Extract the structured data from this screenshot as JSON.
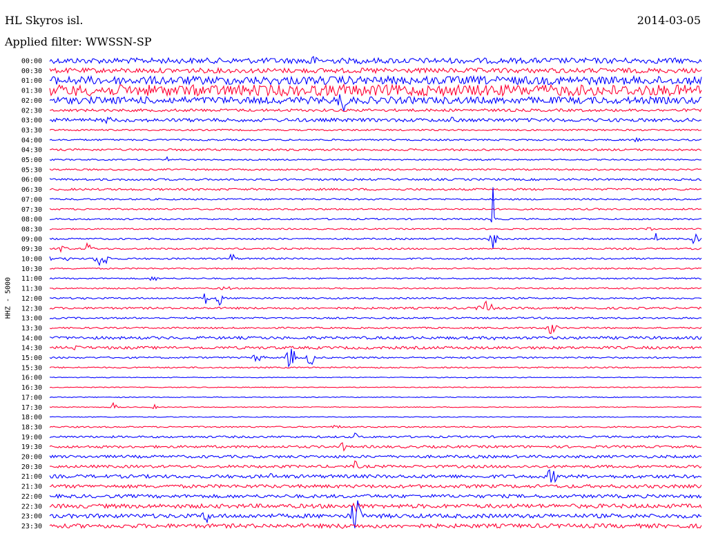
{
  "header": {
    "station": "HL Skyros isl.",
    "date": "2014-03-05",
    "filter": "Applied filter: WWSSN-SP",
    "channel": "HHZ - 5000"
  },
  "chart_data": {
    "type": "line",
    "title": "HL Skyros isl.",
    "subtitle": "Applied filter: WWSSN-SP",
    "ylabel": "HHZ - 5000",
    "colors": [
      "#0000ff",
      "#ff0033"
    ],
    "rows": [
      {
        "label": "00:00",
        "noise": 4,
        "events": [
          [
            0.4,
            5,
            10
          ],
          [
            0.48,
            3,
            6
          ]
        ]
      },
      {
        "label": "00:30",
        "noise": 3.5,
        "events": [
          [
            0.5,
            2,
            5
          ],
          [
            0.78,
            3,
            4
          ]
        ]
      },
      {
        "label": "01:00",
        "noise": 6,
        "events": [
          [
            0.5,
            5,
            6
          ]
        ]
      },
      {
        "label": "01:30",
        "noise": 8,
        "events": [
          [
            0.45,
            6,
            10
          ]
        ]
      },
      {
        "label": "02:00",
        "noise": 5,
        "events": [
          [
            0.45,
            5,
            16
          ],
          [
            0.14,
            3,
            6
          ]
        ]
      },
      {
        "label": "02:30",
        "noise": 2,
        "events": []
      },
      {
        "label": "03:00",
        "noise": 2.5,
        "events": [
          [
            0.09,
            3,
            6
          ],
          [
            0.62,
            3,
            6
          ]
        ]
      },
      {
        "label": "03:30",
        "noise": 1.2,
        "events": []
      },
      {
        "label": "04:00",
        "noise": 1.2,
        "events": [
          [
            0.9,
            4,
            3
          ]
        ]
      },
      {
        "label": "04:30",
        "noise": 1.5,
        "events": [
          [
            0.05,
            5,
            3
          ]
        ]
      },
      {
        "label": "05:00",
        "noise": 1,
        "events": [
          [
            0.18,
            1,
            5
          ]
        ]
      },
      {
        "label": "05:30",
        "noise": 1.2,
        "events": []
      },
      {
        "label": "06:00",
        "noise": 1.5,
        "events": []
      },
      {
        "label": "06:30",
        "noise": 1.5,
        "events": []
      },
      {
        "label": "07:00",
        "noise": 1.2,
        "events": []
      },
      {
        "label": "07:30",
        "noise": 1.2,
        "events": []
      },
      {
        "label": "08:00",
        "noise": 1.2,
        "events": [
          [
            0.68,
            1,
            90
          ]
        ]
      },
      {
        "label": "08:30",
        "noise": 1,
        "events": [
          [
            0.92,
            3,
            4
          ]
        ]
      },
      {
        "label": "09:00",
        "noise": 1.2,
        "events": [
          [
            0.68,
            3,
            14
          ],
          [
            0.93,
            1,
            14
          ],
          [
            0.99,
            3,
            8
          ]
        ]
      },
      {
        "label": "09:30",
        "noise": 1.2,
        "events": [
          [
            0.02,
            3,
            8
          ],
          [
            0.06,
            3,
            10
          ]
        ]
      },
      {
        "label": "10:00",
        "noise": 1.2,
        "events": [
          [
            0.0,
            4,
            5
          ],
          [
            0.03,
            2,
            6
          ],
          [
            0.08,
            5,
            12
          ],
          [
            0.28,
            3,
            8
          ]
        ]
      },
      {
        "label": "10:30",
        "noise": 1,
        "events": []
      },
      {
        "label": "11:00",
        "noise": 1,
        "events": [
          [
            0.16,
            4,
            4
          ]
        ]
      },
      {
        "label": "11:30",
        "noise": 1,
        "events": [
          [
            0.27,
            4,
            4
          ]
        ]
      },
      {
        "label": "12:00",
        "noise": 1.2,
        "events": [
          [
            0.05,
            2,
            3
          ],
          [
            0.24,
            2,
            12
          ],
          [
            0.26,
            2,
            12
          ]
        ]
      },
      {
        "label": "12:30",
        "noise": 1.5,
        "events": [
          [
            0.67,
            6,
            10
          ]
        ]
      },
      {
        "label": "13:00",
        "noise": 1.2,
        "events": []
      },
      {
        "label": "13:30",
        "noise": 1.2,
        "events": [
          [
            0.77,
            4,
            10
          ]
        ]
      },
      {
        "label": "14:00",
        "noise": 2,
        "events": [
          [
            0.68,
            3,
            4
          ]
        ]
      },
      {
        "label": "14:30",
        "noise": 2,
        "events": [
          [
            0.04,
            5,
            4
          ]
        ]
      },
      {
        "label": "15:00",
        "noise": 1.2,
        "events": [
          [
            0.32,
            5,
            6
          ],
          [
            0.37,
            3,
            18
          ],
          [
            0.4,
            3,
            12
          ]
        ]
      },
      {
        "label": "15:30",
        "noise": 1,
        "events": []
      },
      {
        "label": "16:00",
        "noise": 0.6,
        "events": [
          [
            0.64,
            1,
            2
          ]
        ]
      },
      {
        "label": "16:30",
        "noise": 0.6,
        "events": []
      },
      {
        "label": "17:00",
        "noise": 0.6,
        "events": [
          [
            0.11,
            1,
            2
          ]
        ]
      },
      {
        "label": "17:30",
        "noise": 0.6,
        "events": [
          [
            0.1,
            2,
            10
          ],
          [
            0.16,
            2,
            4
          ]
        ]
      },
      {
        "label": "18:00",
        "noise": 0.6,
        "events": []
      },
      {
        "label": "18:30",
        "noise": 1,
        "events": [
          [
            0.44,
            4,
            3
          ]
        ]
      },
      {
        "label": "19:00",
        "noise": 1.5,
        "events": [
          [
            0.47,
            1,
            12
          ]
        ]
      },
      {
        "label": "19:30",
        "noise": 1.8,
        "events": [
          [
            0.45,
            2,
            8
          ]
        ]
      },
      {
        "label": "20:00",
        "noise": 2,
        "events": []
      },
      {
        "label": "20:30",
        "noise": 2,
        "events": [
          [
            0.47,
            2,
            10
          ]
        ]
      },
      {
        "label": "21:00",
        "noise": 2.5,
        "events": [
          [
            0.34,
            3,
            5
          ],
          [
            0.4,
            3,
            4
          ],
          [
            0.77,
            4,
            12
          ]
        ]
      },
      {
        "label": "21:30",
        "noise": 2.5,
        "events": []
      },
      {
        "label": "22:00",
        "noise": 2.5,
        "events": []
      },
      {
        "label": "22:30",
        "noise": 3,
        "events": [
          [
            0.47,
            2,
            12
          ]
        ]
      },
      {
        "label": "23:00",
        "noise": 3,
        "events": [
          [
            0.24,
            3,
            12
          ],
          [
            0.47,
            4,
            28
          ]
        ]
      },
      {
        "label": "23:30",
        "noise": 3,
        "events": [
          [
            0.45,
            1,
            10
          ]
        ]
      }
    ]
  }
}
